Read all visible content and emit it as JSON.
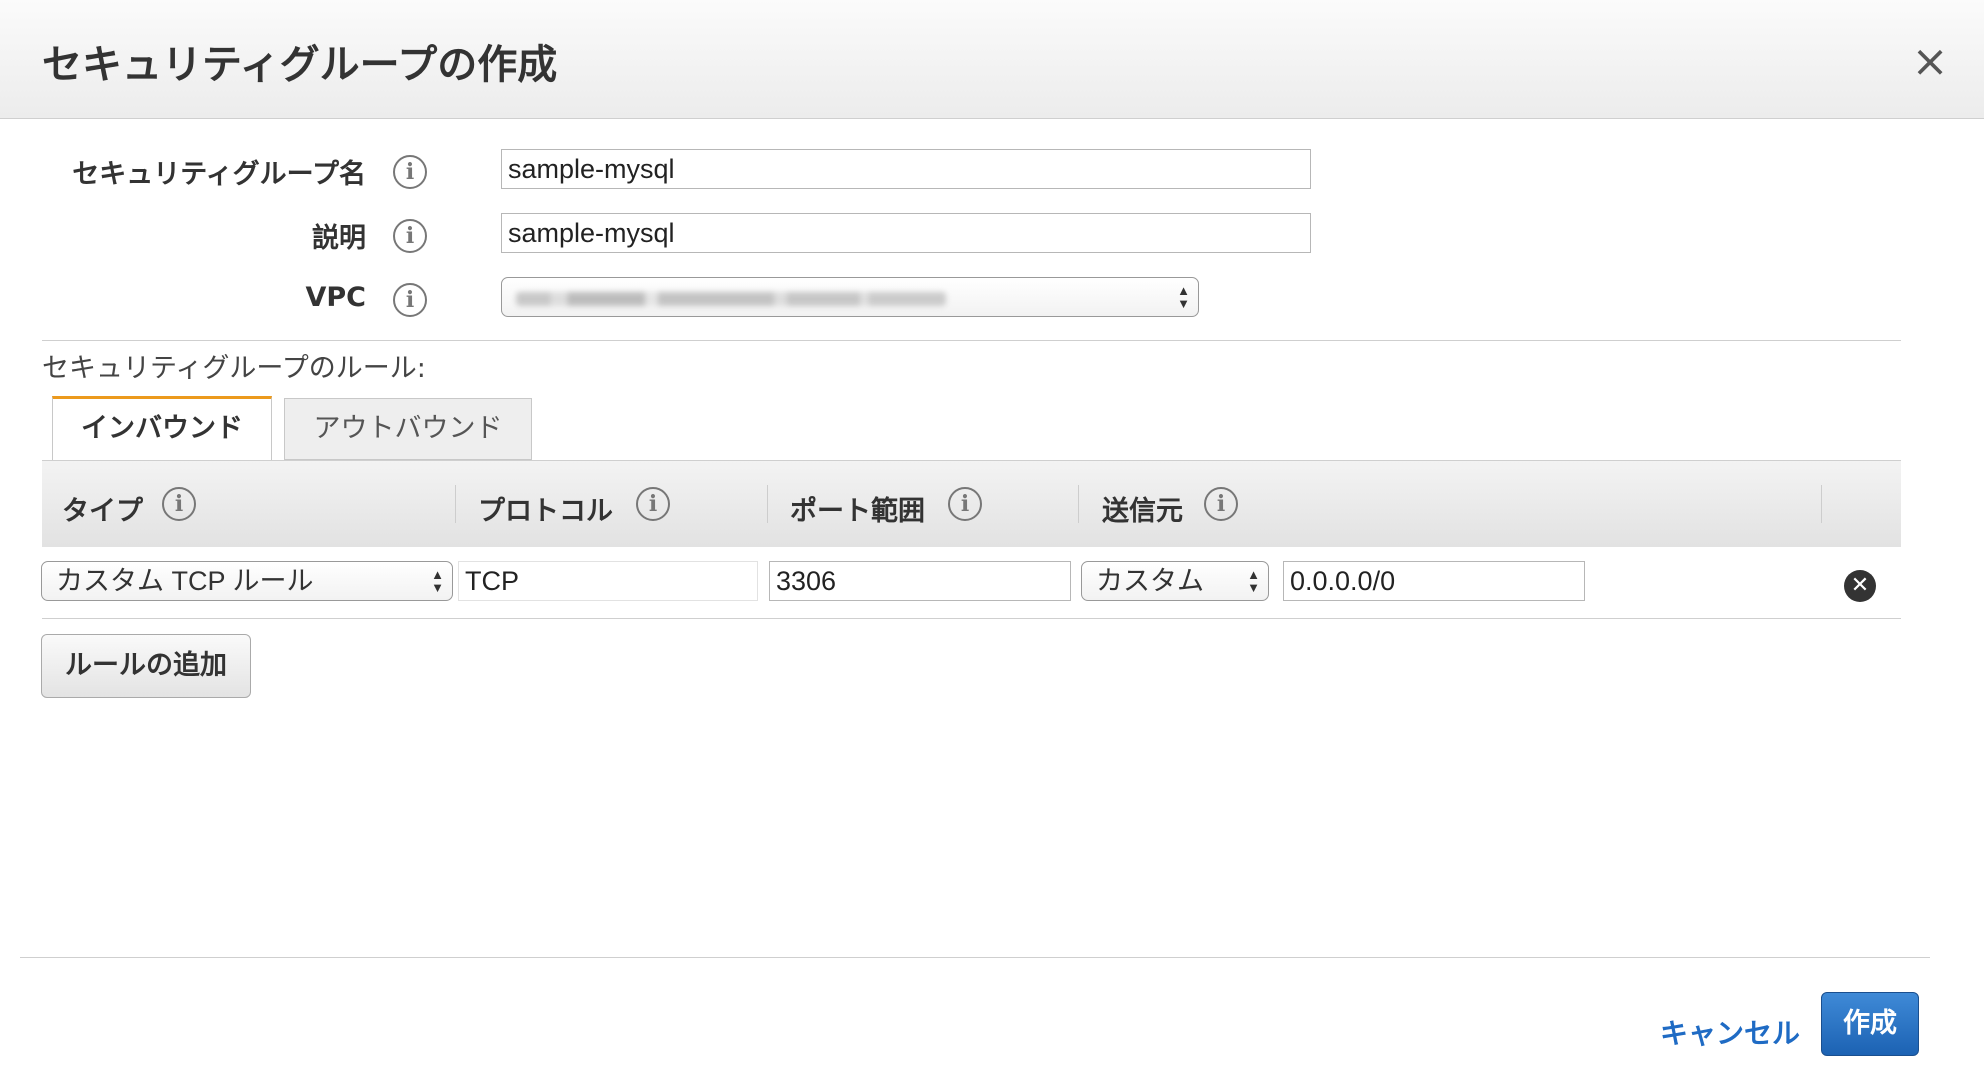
{
  "dialog": {
    "title": "セキュリティグループの作成",
    "close_icon": "close-icon"
  },
  "form": {
    "name_label": "セキュリティグループ名",
    "name_value": "sample-mysql",
    "description_label": "説明",
    "description_value": "sample-mysql",
    "vpc_label": "VPC",
    "vpc_value_blurred": true,
    "info_icon_glyph": "i"
  },
  "rules": {
    "section_label": "セキュリティグループのルール:",
    "tabs": [
      {
        "label": "インバウンド",
        "active": true
      },
      {
        "label": "アウトバウンド",
        "active": false
      }
    ],
    "columns": [
      {
        "label": "タイプ"
      },
      {
        "label": "プロトコル"
      },
      {
        "label": "ポート範囲"
      },
      {
        "label": "送信元"
      }
    ],
    "rows": [
      {
        "type": "カスタム TCP ルール",
        "protocol": "TCP",
        "port_range": "3306",
        "source_type": "カスタム",
        "source_value": "0.0.0.0/0"
      }
    ],
    "add_rule_label": "ルールの追加"
  },
  "footer": {
    "cancel_label": "キャンセル",
    "create_label": "作成"
  },
  "colors": {
    "active_tab_accent": "#ec9a1d",
    "primary_button": "#2a72c3",
    "link": "#1f6bc4"
  }
}
